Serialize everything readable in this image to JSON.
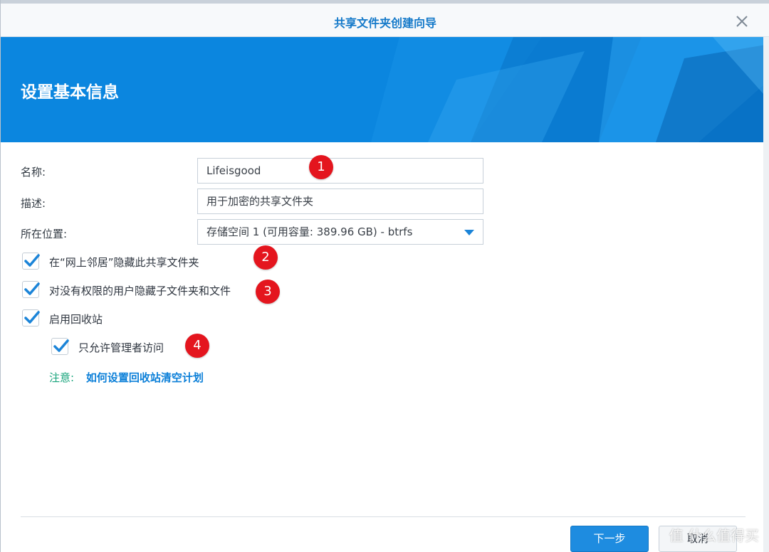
{
  "window": {
    "title": "共享文件夹创建向导"
  },
  "banner": {
    "heading": "设置基本信息"
  },
  "form": {
    "name_label": "名称:",
    "name_value": "Lifeisgood",
    "description_label": "描述:",
    "description_value": "用于加密的共享文件夹",
    "location_label": "所在位置:",
    "location_value": "存储空间 1 (可用容量:   389.96 GB) - btrfs"
  },
  "options": [
    {
      "label": "在“网上邻居”隐藏此共享文件夹",
      "checked": true
    },
    {
      "label": "对没有权限的用户隐藏子文件夹和文件",
      "checked": true
    },
    {
      "label": "启用回收站",
      "checked": true
    },
    {
      "label": "只允许管理者访问",
      "checked": true
    }
  ],
  "annotations": [
    "1",
    "2",
    "3",
    "4"
  ],
  "note": {
    "label": "注意:",
    "link": "如何设置回收站清空计划"
  },
  "footer": {
    "next_label": "下一步",
    "cancel_label": "取消"
  },
  "watermark": "值 什么值得买",
  "colors": {
    "accent": "#1e8ce0",
    "banner": "#0b86df",
    "badge": "#e4151e",
    "note_label": "#15a37a"
  }
}
